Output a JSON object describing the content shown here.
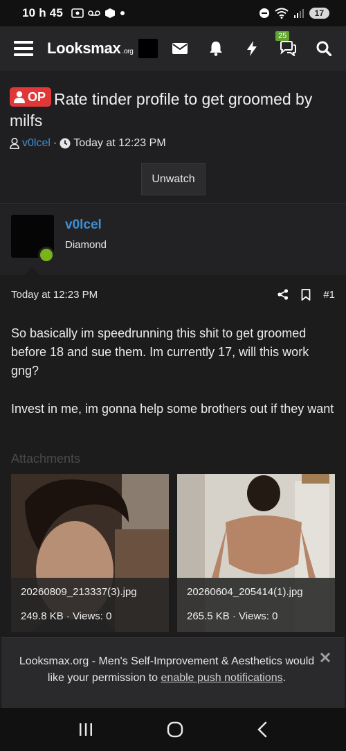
{
  "status_bar": {
    "time": "10 h 45",
    "battery": "17"
  },
  "navbar": {
    "logo": "Looksmax",
    "logo_suffix": ".org",
    "badge_count": "25",
    "icons": [
      "menu-icon",
      "mail-icon",
      "bell-icon",
      "lightning-icon",
      "chat-icon",
      "search-icon"
    ]
  },
  "thread": {
    "op_label": "OP",
    "title": "Rate tinder profile to get groomed by milfs",
    "author": "v0lcel",
    "time": "Today at 12:23 PM",
    "unwatch_label": "Unwatch"
  },
  "post": {
    "author": "v0lcel",
    "rank": "Diamond",
    "time": "Today at 12:23 PM",
    "number": "#1",
    "paragraphs": [
      "So basically im speedrunning this shit to get groomed before 18 and sue them. Im currently 17, will this work gng?",
      "Invest in me, im gonna help some brothers out if they want"
    ],
    "attachments_title": "Attachments",
    "attachments": [
      {
        "name": "20260809_213337(3).jpg",
        "info": "249.8 KB · Views: 0"
      },
      {
        "name": "20260604_205414(1).jpg",
        "info": "265.5 KB · Views: 0"
      }
    ]
  },
  "notice": {
    "text_before": "Looksmax.org - Men's Self-Improvement & Aesthetics would like your permission to ",
    "link": "enable push notifications",
    "text_after": "."
  },
  "colors": {
    "accent_link": "#3d8fd6",
    "op_badge": "#e03838",
    "online": "#7ab319",
    "badge": "#63a331"
  }
}
